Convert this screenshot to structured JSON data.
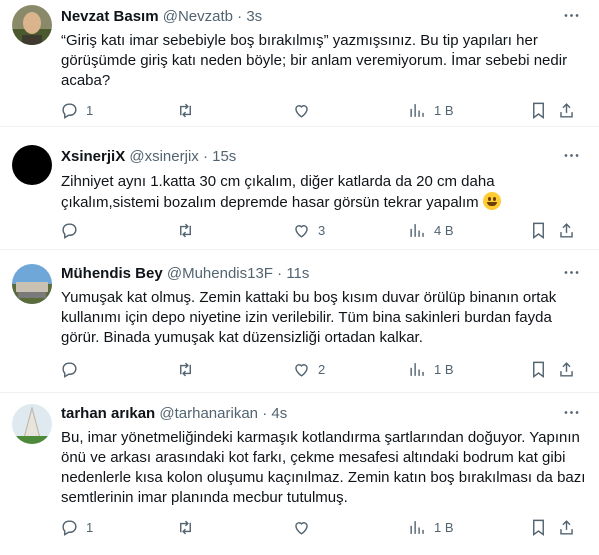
{
  "tweets": [
    {
      "name": "Nevzat Basım",
      "handle": "@Nevzatb",
      "sep": "·",
      "time": "3s",
      "text": "“Giriş katı imar sebebiyle boş bırakılmış” yazmışsınız. Bu tip yapıları her görüşümde giriş katı neden böyle; bir anlam veremiyorum. İmar sebebi nedir acaba?",
      "reply_count": "1",
      "retweet_count": "",
      "like_count": "",
      "view_count": "1 B"
    },
    {
      "name": "XsinerjiX",
      "handle": "@xsinerjix",
      "sep": "·",
      "time": "15s",
      "text": "Zihniyet aynı 1.katta 30 cm çıkalım, diğer katlarda da 20 cm daha çıkalım,sistemi bozalım depremde hasar görsün tekrar yapalım",
      "reply_count": "",
      "retweet_count": "",
      "like_count": "3",
      "view_count": "4 B"
    },
    {
      "name": "Mühendis Bey",
      "handle": "@Muhendis13F",
      "sep": "·",
      "time": "11s",
      "text": "Yumuşak kat olmuş. Zemin kattaki bu boş kısım duvar örülüp binanın ortak kullanımı için depo niyetine izin verilebilir. Tüm bina sakinleri burdan fayda görür. Binada yumuşak kat düzensizliği ortadan kalkar.",
      "reply_count": "",
      "retweet_count": "",
      "like_count": "2",
      "view_count": "1 B"
    },
    {
      "name": "tarhan arıkan",
      "handle": "@tarhanarikan",
      "sep": "·",
      "time": "4s",
      "text": "Bu, imar yönetmeliğindeki karmaşık kotlandırma şartlarından doğuyor. Yapının önü ve arkası arasındaki kot farkı, çekme mesafesi altındaki bodrum kat gibi nedenlerle kısa kolon oluşumu kaçınılmaz. Zemin katın boş bırakılması da  bazı semtlerinin imar planında mecbur tutulmuş.",
      "reply_count": "1",
      "retweet_count": "",
      "like_count": "",
      "view_count": "1 B"
    }
  ],
  "icons": {
    "more": "more-dots-icon",
    "reply": "reply-icon",
    "retweet": "retweet-icon",
    "like": "like-icon",
    "views": "views-icon",
    "bookmark": "bookmark-icon",
    "share": "share-icon"
  },
  "colors": {
    "secondary_text": "#536471",
    "divider": "#eff3f4"
  }
}
